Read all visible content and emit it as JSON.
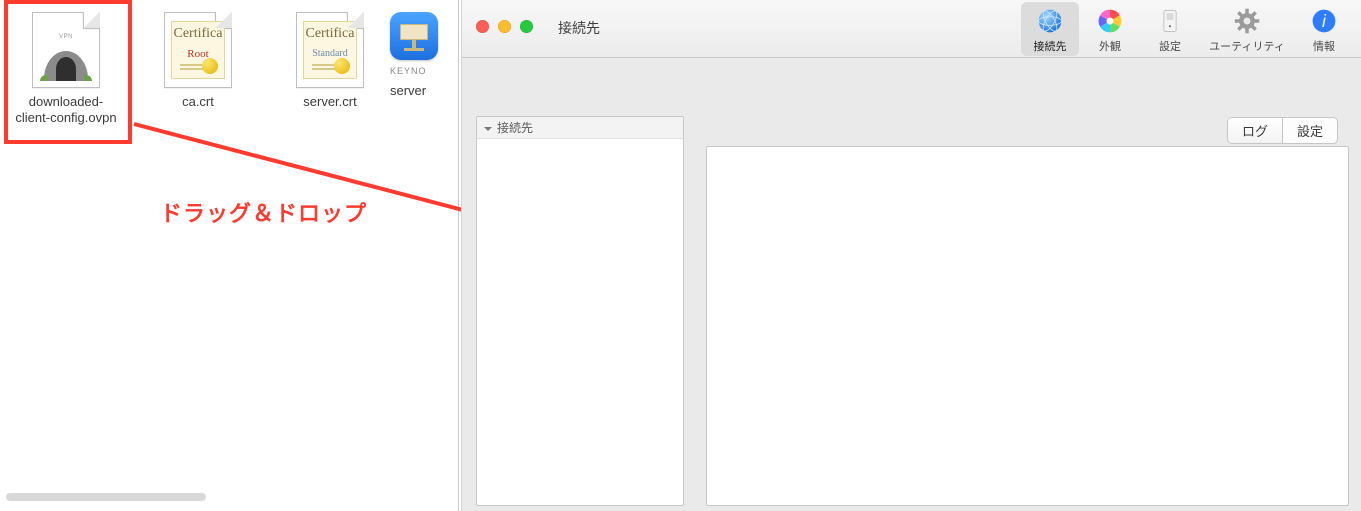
{
  "annotation_text": "ドラッグ＆ドロップ",
  "finder": {
    "files": [
      {
        "name": "downloaded-\nclient-config.ovpn",
        "kind": "ovpn"
      },
      {
        "name": "ca.crt",
        "kind": "cert-root"
      },
      {
        "name": "server.crt",
        "kind": "cert-standard"
      },
      {
        "name": "server",
        "kind": "keynote",
        "truncated_label": "KEYNO"
      }
    ],
    "cert_heading": "Certifica",
    "cert_root_sub": "Root",
    "cert_std_sub": "Standard",
    "ovpn_tag": "VPN"
  },
  "prefs": {
    "window_title": "接続先",
    "toolbar": [
      {
        "id": "connections",
        "label": "接続先",
        "selected": true
      },
      {
        "id": "appearance",
        "label": "外観"
      },
      {
        "id": "settings",
        "label": "設定"
      },
      {
        "id": "utility",
        "label": "ユーティリティ",
        "wide": true
      },
      {
        "id": "info",
        "label": "情報"
      }
    ],
    "sidebar_header": "接続先",
    "seg": {
      "log": "ログ",
      "settings": "設定"
    }
  }
}
